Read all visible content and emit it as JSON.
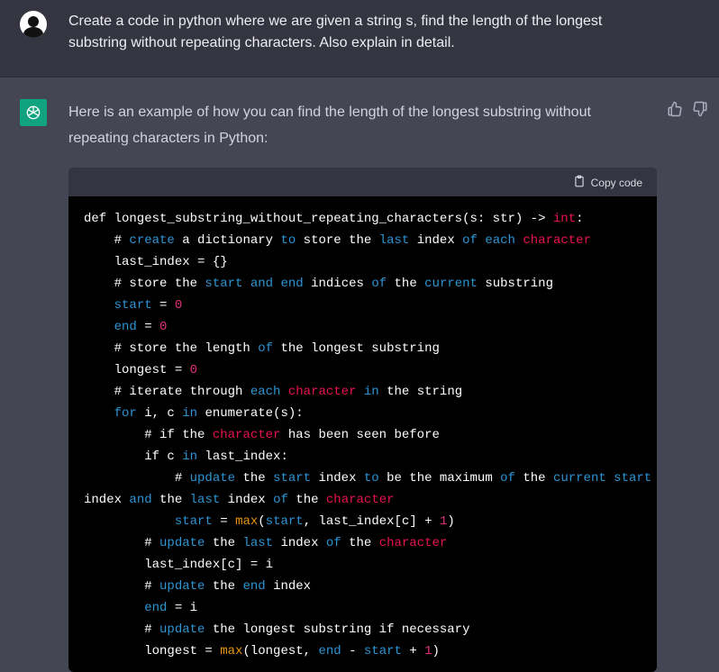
{
  "user_message": "Create a code in python where we are given a string s, find the length of the longest substring  without repeating characters. Also explain in detail.",
  "assistant_intro": "Here is an example of how you can find the length of the longest substring without repeating characters in Python:",
  "code_block": {
    "copy_label": "Copy code",
    "lines": [
      [
        {
          "t": "def longest_substring_without_repeating_characters(s: str) -> "
        },
        {
          "t": "int",
          "c": "kw-red"
        },
        {
          "t": ":"
        }
      ],
      [
        {
          "t": "    # "
        },
        {
          "t": "create",
          "c": "kw-blue"
        },
        {
          "t": " a dictionary "
        },
        {
          "t": "to",
          "c": "kw-blue"
        },
        {
          "t": " store the "
        },
        {
          "t": "last",
          "c": "kw-blue"
        },
        {
          "t": " index "
        },
        {
          "t": "of",
          "c": "kw-blue"
        },
        {
          "t": " "
        },
        {
          "t": "each",
          "c": "kw-blue"
        },
        {
          "t": " "
        },
        {
          "t": "character",
          "c": "kw-red"
        }
      ],
      [
        {
          "t": "    last_index = {}"
        }
      ],
      [
        {
          "t": "    # store the "
        },
        {
          "t": "start",
          "c": "kw-blue"
        },
        {
          "t": " "
        },
        {
          "t": "and",
          "c": "kw-blue"
        },
        {
          "t": " "
        },
        {
          "t": "end",
          "c": "kw-blue"
        },
        {
          "t": " indices "
        },
        {
          "t": "of",
          "c": "kw-blue"
        },
        {
          "t": " the "
        },
        {
          "t": "current",
          "c": "kw-blue"
        },
        {
          "t": " substring"
        }
      ],
      [
        {
          "t": "    "
        },
        {
          "t": "start",
          "c": "kw-blue"
        },
        {
          "t": " = "
        },
        {
          "t": "0",
          "c": "num"
        }
      ],
      [
        {
          "t": "    "
        },
        {
          "t": "end",
          "c": "kw-blue"
        },
        {
          "t": " = "
        },
        {
          "t": "0",
          "c": "num"
        }
      ],
      [
        {
          "t": "    # store the length "
        },
        {
          "t": "of",
          "c": "kw-blue"
        },
        {
          "t": " the longest substring"
        }
      ],
      [
        {
          "t": "    longest = "
        },
        {
          "t": "0",
          "c": "num"
        }
      ],
      [
        {
          "t": "    # iterate through "
        },
        {
          "t": "each",
          "c": "kw-blue"
        },
        {
          "t": " "
        },
        {
          "t": "character",
          "c": "kw-red"
        },
        {
          "t": " "
        },
        {
          "t": "in",
          "c": "kw-blue"
        },
        {
          "t": " the string"
        }
      ],
      [
        {
          "t": "    "
        },
        {
          "t": "for",
          "c": "kw-blue"
        },
        {
          "t": " i, c "
        },
        {
          "t": "in",
          "c": "kw-blue"
        },
        {
          "t": " enumerate(s):"
        }
      ],
      [
        {
          "t": "        # if the "
        },
        {
          "t": "character",
          "c": "kw-red"
        },
        {
          "t": " has been seen before"
        }
      ],
      [
        {
          "t": "        if c "
        },
        {
          "t": "in",
          "c": "kw-blue"
        },
        {
          "t": " last_index:"
        }
      ],
      [
        {
          "t": "            # "
        },
        {
          "t": "update",
          "c": "kw-blue"
        },
        {
          "t": " the "
        },
        {
          "t": "start",
          "c": "kw-blue"
        },
        {
          "t": " index "
        },
        {
          "t": "to",
          "c": "kw-blue"
        },
        {
          "t": " be the maximum "
        },
        {
          "t": "of",
          "c": "kw-blue"
        },
        {
          "t": " the "
        },
        {
          "t": "current",
          "c": "kw-blue"
        },
        {
          "t": " "
        },
        {
          "t": "start",
          "c": "kw-blue"
        }
      ],
      [
        {
          "t": "index "
        },
        {
          "t": "and",
          "c": "kw-blue"
        },
        {
          "t": " the "
        },
        {
          "t": "last",
          "c": "kw-blue"
        },
        {
          "t": " index "
        },
        {
          "t": "of",
          "c": "kw-blue"
        },
        {
          "t": " the "
        },
        {
          "t": "character",
          "c": "kw-red"
        }
      ],
      [
        {
          "t": "            "
        },
        {
          "t": "start",
          "c": "kw-blue"
        },
        {
          "t": " = "
        },
        {
          "t": "max",
          "c": "builtin"
        },
        {
          "t": "("
        },
        {
          "t": "start",
          "c": "kw-blue"
        },
        {
          "t": ", last_index[c] + "
        },
        {
          "t": "1",
          "c": "num"
        },
        {
          "t": ")"
        }
      ],
      [
        {
          "t": "        # "
        },
        {
          "t": "update",
          "c": "kw-blue"
        },
        {
          "t": " the "
        },
        {
          "t": "last",
          "c": "kw-blue"
        },
        {
          "t": " index "
        },
        {
          "t": "of",
          "c": "kw-blue"
        },
        {
          "t": " the "
        },
        {
          "t": "character",
          "c": "kw-red"
        }
      ],
      [
        {
          "t": "        last_index[c] = i"
        }
      ],
      [
        {
          "t": "        # "
        },
        {
          "t": "update",
          "c": "kw-blue"
        },
        {
          "t": " the "
        },
        {
          "t": "end",
          "c": "kw-blue"
        },
        {
          "t": " index"
        }
      ],
      [
        {
          "t": "        "
        },
        {
          "t": "end",
          "c": "kw-blue"
        },
        {
          "t": " = i"
        }
      ],
      [
        {
          "t": "        # "
        },
        {
          "t": "update",
          "c": "kw-blue"
        },
        {
          "t": " the longest substring if necessary"
        }
      ],
      [
        {
          "t": "        longest = "
        },
        {
          "t": "max",
          "c": "builtin"
        },
        {
          "t": "(longest, "
        },
        {
          "t": "end",
          "c": "kw-blue"
        },
        {
          "t": " - "
        },
        {
          "t": "start",
          "c": "kw-blue"
        },
        {
          "t": " + "
        },
        {
          "t": "1",
          "c": "num"
        },
        {
          "t": ")"
        }
      ]
    ]
  },
  "icons": {
    "user_avatar": "user-avatar-icon",
    "assistant_avatar": "openai-logo-icon",
    "thumbs_up": "thumbs-up-icon",
    "thumbs_down": "thumbs-down-icon",
    "copy": "clipboard-icon"
  },
  "colors": {
    "user_bg": "#343541",
    "assistant_bg": "#444654",
    "code_bg": "#000000",
    "brand_green": "#10a37f",
    "syntax_blue": "#2e95d3",
    "syntax_red": "#e9134e",
    "syntax_number": "#df3079",
    "syntax_builtin": "#e9950c"
  }
}
